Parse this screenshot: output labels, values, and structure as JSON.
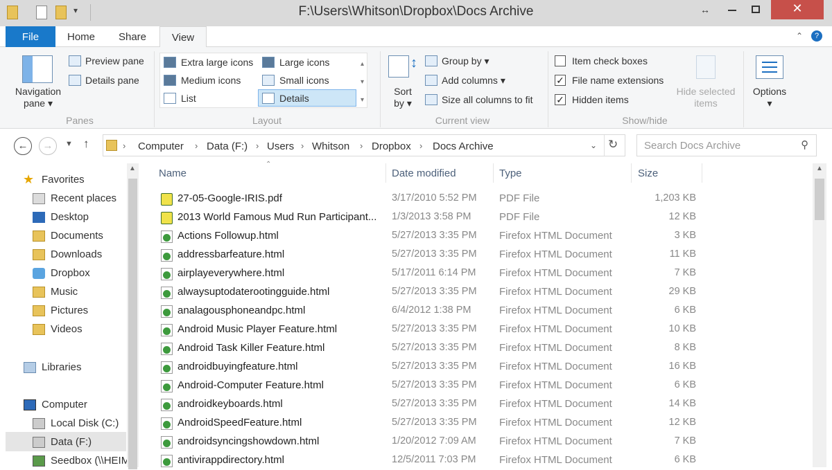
{
  "window": {
    "title": "F:\\Users\\Whitson\\Dropbox\\Docs Archive"
  },
  "ribbon_tabs": [
    "File",
    "Home",
    "Share",
    "View"
  ],
  "ribbon": {
    "panes": {
      "navigation_pane": "Navigation pane",
      "preview_pane": "Preview pane",
      "details_pane": "Details pane",
      "group": "Panes"
    },
    "layout": {
      "extra_large": "Extra large icons",
      "large": "Large icons",
      "medium": "Medium icons",
      "small": "Small icons",
      "list": "List",
      "details": "Details",
      "group": "Layout"
    },
    "current_view": {
      "sort_by": "Sort by",
      "group_by": "Group by",
      "add_columns": "Add columns",
      "size_all": "Size all columns to fit",
      "group": "Current view"
    },
    "show_hide": {
      "item_check_boxes": "Item check boxes",
      "file_name_extensions": "File name extensions",
      "hidden_items": "Hidden items",
      "hide_selected": "Hide selected items",
      "group": "Show/hide",
      "checks": [
        false,
        true,
        true
      ]
    },
    "options": "Options"
  },
  "address": {
    "crumbs": [
      "Computer",
      "Data (F:)",
      "Users",
      "Whitson",
      "Dropbox",
      "Docs Archive"
    ],
    "search_placeholder": "Search Docs Archive"
  },
  "nav": {
    "favorites": "Favorites",
    "favorite_items": [
      "Recent places",
      "Desktop",
      "Documents",
      "Downloads",
      "Dropbox",
      "Music",
      "Pictures",
      "Videos"
    ],
    "libraries": "Libraries",
    "computer": "Computer",
    "computer_items": [
      "Local Disk (C:)",
      "Data (F:)",
      "Seedbox (\\\\HEIM"
    ]
  },
  "columns": [
    "Name",
    "Date modified",
    "Type",
    "Size"
  ],
  "files": [
    {
      "name": "27-05-Google-IRIS.pdf",
      "date": "3/17/2010 5:52 PM",
      "type": "PDF File",
      "size": "1,203 KB",
      "icon": "pdf"
    },
    {
      "name": "2013 World Famous Mud Run Participant...",
      "date": "1/3/2013 3:58 PM",
      "type": "PDF File",
      "size": "12 KB",
      "icon": "pdf"
    },
    {
      "name": "Actions Followup.html",
      "date": "5/27/2013 3:35 PM",
      "type": "Firefox HTML Document",
      "size": "3 KB",
      "icon": "html"
    },
    {
      "name": "addressbarfeature.html",
      "date": "5/27/2013 3:35 PM",
      "type": "Firefox HTML Document",
      "size": "11 KB",
      "icon": "html"
    },
    {
      "name": "airplayeverywhere.html",
      "date": "5/17/2011 6:14 PM",
      "type": "Firefox HTML Document",
      "size": "7 KB",
      "icon": "html"
    },
    {
      "name": "alwaysuptodaterootingguide.html",
      "date": "5/27/2013 3:35 PM",
      "type": "Firefox HTML Document",
      "size": "29 KB",
      "icon": "html"
    },
    {
      "name": "analagousphoneandpc.html",
      "date": "6/4/2012 1:38 PM",
      "type": "Firefox HTML Document",
      "size": "6 KB",
      "icon": "html"
    },
    {
      "name": "Android Music Player Feature.html",
      "date": "5/27/2013 3:35 PM",
      "type": "Firefox HTML Document",
      "size": "10 KB",
      "icon": "html"
    },
    {
      "name": "Android Task Killer Feature.html",
      "date": "5/27/2013 3:35 PM",
      "type": "Firefox HTML Document",
      "size": "8 KB",
      "icon": "html"
    },
    {
      "name": "androidbuyingfeature.html",
      "date": "5/27/2013 3:35 PM",
      "type": "Firefox HTML Document",
      "size": "16 KB",
      "icon": "html"
    },
    {
      "name": "Android-Computer Feature.html",
      "date": "5/27/2013 3:35 PM",
      "type": "Firefox HTML Document",
      "size": "6 KB",
      "icon": "html"
    },
    {
      "name": "androidkeyboards.html",
      "date": "5/27/2013 3:35 PM",
      "type": "Firefox HTML Document",
      "size": "14 KB",
      "icon": "html"
    },
    {
      "name": "AndroidSpeedFeature.html",
      "date": "5/27/2013 3:35 PM",
      "type": "Firefox HTML Document",
      "size": "12 KB",
      "icon": "html"
    },
    {
      "name": "androidsyncingshowdown.html",
      "date": "1/20/2012 7:09 AM",
      "type": "Firefox HTML Document",
      "size": "7 KB",
      "icon": "html"
    },
    {
      "name": "antivirappdirectory.html",
      "date": "12/5/2011 7:03 PM",
      "type": "Firefox HTML Document",
      "size": "6 KB",
      "icon": "html"
    }
  ],
  "colors": {
    "file_tab": "#1979ca",
    "ribbon_bg": "#f5f6f7",
    "titlebar": "#dadada",
    "close_button": "#c7504a",
    "folder_yellow": "#e8c35a"
  }
}
